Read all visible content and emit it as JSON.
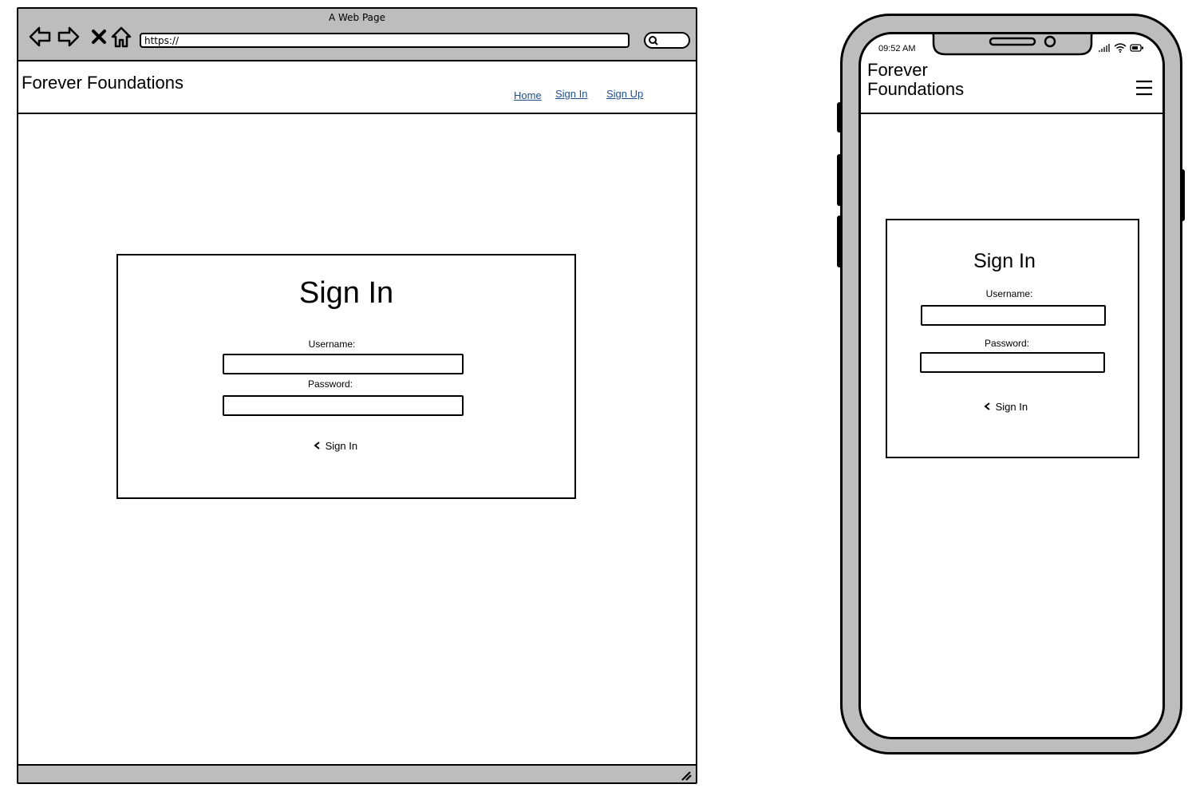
{
  "browser": {
    "window_title": "A Web Page",
    "url": "https://",
    "brand": "Forever Foundations",
    "nav": [
      {
        "label": "Home"
      },
      {
        "label": "Sign In"
      },
      {
        "label": "Sign Up"
      }
    ]
  },
  "signin": {
    "title": "Sign In",
    "username_label": "Username:",
    "username_value": "",
    "password_label": "Password:",
    "password_value": "",
    "submit_label": "Sign In"
  },
  "phone": {
    "time": "09:52 AM",
    "brand_line1": "Forever",
    "brand_line2": "Foundations"
  },
  "colors": {
    "chrome_gray": "#bdbdbd",
    "link_blue": "#1f4f8f",
    "outline": "#000000"
  }
}
